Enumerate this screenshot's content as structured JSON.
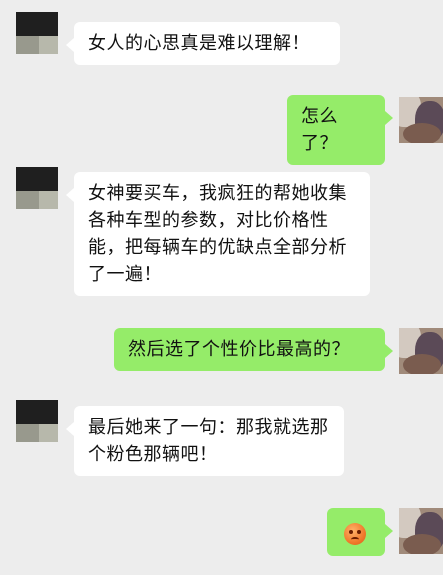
{
  "messages": [
    {
      "side": "left",
      "text": "女人的心思真是难以理解！"
    },
    {
      "side": "right",
      "text": "怎么了？"
    },
    {
      "side": "left",
      "text": "女神要买车，我疯狂的帮她收集各种车型的参数，对比价格性能，把每辆车的优缺点全部分析了一遍！"
    },
    {
      "side": "right",
      "text": "然后选了个性价比最高的？"
    },
    {
      "side": "left",
      "text": "最后她来了一句：那我就选那个粉色那辆吧！"
    },
    {
      "side": "right",
      "emoji": "angry-face-emoji"
    }
  ],
  "colors": {
    "background": "#ededed",
    "left_bubble": "#ffffff",
    "right_bubble": "#95ec69"
  }
}
